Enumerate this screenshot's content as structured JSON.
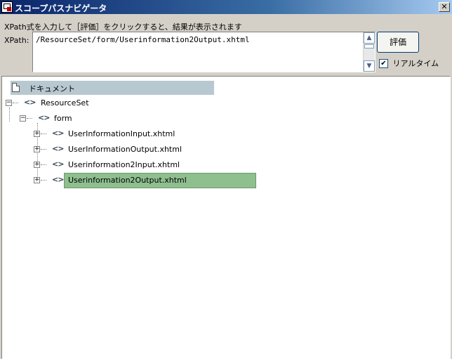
{
  "window": {
    "title": "スコープパスナビゲータ",
    "close_glyph": "✕"
  },
  "form": {
    "instruction": "XPath式を入力して［評価］をクリックすると、結果が表示されます",
    "xpath_label": "XPath:",
    "xpath_value": "/ResourceSet/form/Userinformation2Output.xhtml",
    "evaluate_label": "評価",
    "realtime_label": "リアルタイム",
    "realtime_checked": true,
    "check_glyph": "✔"
  },
  "tree": {
    "root_label": "ドキュメント",
    "resource_set": "ResourceSet",
    "form": "form",
    "items": [
      "UserInformationInput.xhtml",
      "UserInformationOutput.xhtml",
      "Userinformation2Input.xhtml",
      "Userinformation2Output.xhtml"
    ],
    "selected_index": 3,
    "expand_glyph": "+",
    "collapse_glyph": "−",
    "element_glyph": "<>"
  },
  "scrollbar": {
    "up_glyph": "▲",
    "down_glyph": "▼"
  }
}
